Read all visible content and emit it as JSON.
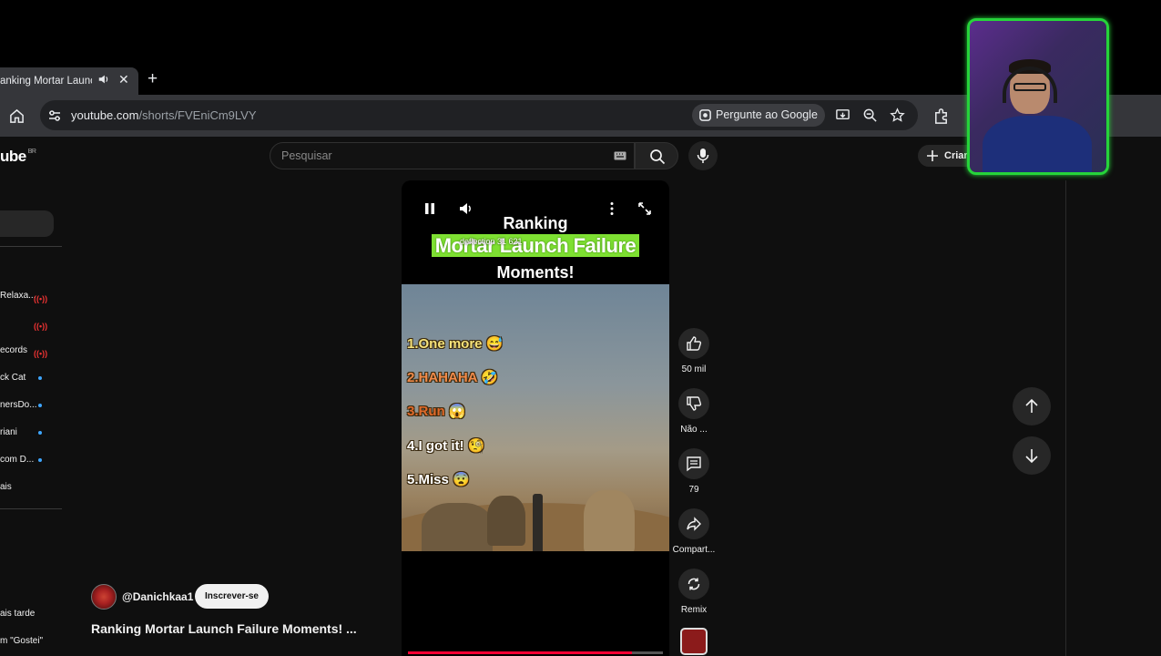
{
  "browser": {
    "tab_title": "anking Mortar Launc",
    "tab_close": "✕",
    "new_tab": "+",
    "url_host": "youtube.com",
    "url_path": "/shorts/FVEniCm9LVY",
    "ask_google": "Pergunte ao Google"
  },
  "youtube": {
    "logo": "ube",
    "region": "BR",
    "search_placeholder": "Pesquisar",
    "create_label": "Criar"
  },
  "sidebar": {
    "subscriptions": [
      {
        "name": "Relaxa...",
        "live": true
      },
      {
        "name": "",
        "live": true
      },
      {
        "name": "ecords",
        "live": true
      },
      {
        "name": "ck Cat",
        "live": false
      },
      {
        "name": "nersDo...",
        "live": false
      },
      {
        "name": "riani",
        "live": false
      },
      {
        "name": "com D...",
        "live": false
      },
      {
        "name": "ais",
        "live": false
      }
    ],
    "live_marker": "((•))",
    "watch_later": "ais tarde",
    "liked": "m \"Gostei\""
  },
  "short": {
    "title_line1": "Ranking",
    "title_line2": "Mortar Launch Failure",
    "title_line3": "Moments!",
    "overlay_text": "deflection 31 621",
    "ranks": [
      {
        "text": "1.One more",
        "emoji": "😅",
        "color": "#f5e27a"
      },
      {
        "text": "2.HAHAHA",
        "emoji": "🤣",
        "color": "#f08a4a"
      },
      {
        "text": "3.Run",
        "emoji": "😱",
        "color": "#e06a2a"
      },
      {
        "text": "4.I got it!",
        "emoji": "🧐",
        "color": "#ffffff"
      },
      {
        "text": "5.Miss",
        "emoji": "😨",
        "color": "#ffffff"
      }
    ],
    "progress": 0.88,
    "author": "@Danichkaa1",
    "subscribe_label": "Inscrever-se",
    "caption": "Ranking Mortar Launch Failure Moments!  ..."
  },
  "actions": {
    "likes": "50 mil",
    "dislike": "Não ...",
    "comments": "79",
    "share": "Compart...",
    "remix": "Remix"
  },
  "colors": {
    "accent_green": "#7ee032",
    "progress_red": "#ff0033",
    "webcam_border": "#26d43a"
  }
}
